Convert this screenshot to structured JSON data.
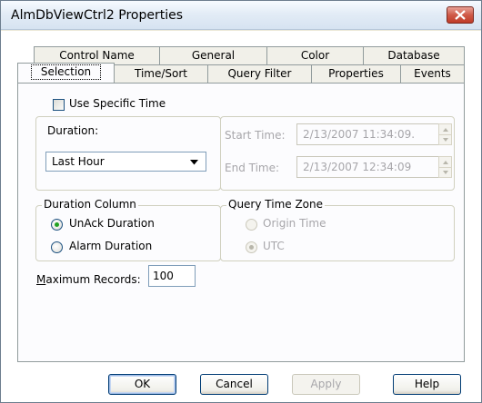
{
  "window": {
    "title": "AlmDbViewCtrl2 Properties"
  },
  "tabs_row1": [
    "Control Name",
    "General",
    "Color",
    "Database"
  ],
  "tabs_row2": [
    "Selection",
    "Time/Sort",
    "Query Filter",
    "Properties",
    "Events"
  ],
  "selection": {
    "use_specific_time": {
      "label": "Use Specific Time",
      "checked": false
    },
    "duration": {
      "label": "Duration:",
      "value": "Last Hour"
    },
    "start_time": {
      "label": "Start Time:",
      "value": "2/13/2007 11:34:09."
    },
    "end_time": {
      "label": "End Time:",
      "value": "2/13/2007 12:34:09"
    },
    "duration_column": {
      "legend": "Duration Column",
      "options": [
        {
          "label": "UnAck Duration",
          "selected": true
        },
        {
          "label": "Alarm Duration",
          "selected": false
        }
      ]
    },
    "query_time_zone": {
      "legend": "Query Time Zone",
      "options": [
        {
          "label": "Origin Time",
          "selected": false
        },
        {
          "label": "UTC",
          "selected": true
        }
      ]
    },
    "max_records": {
      "label": "Maximum Records:",
      "value": "100"
    }
  },
  "buttons": {
    "ok": "OK",
    "cancel": "Cancel",
    "apply": "Apply",
    "help": "Help"
  },
  "colors": {
    "radio_dot": "#21a121",
    "disabled_text": "#a7a6aa"
  }
}
